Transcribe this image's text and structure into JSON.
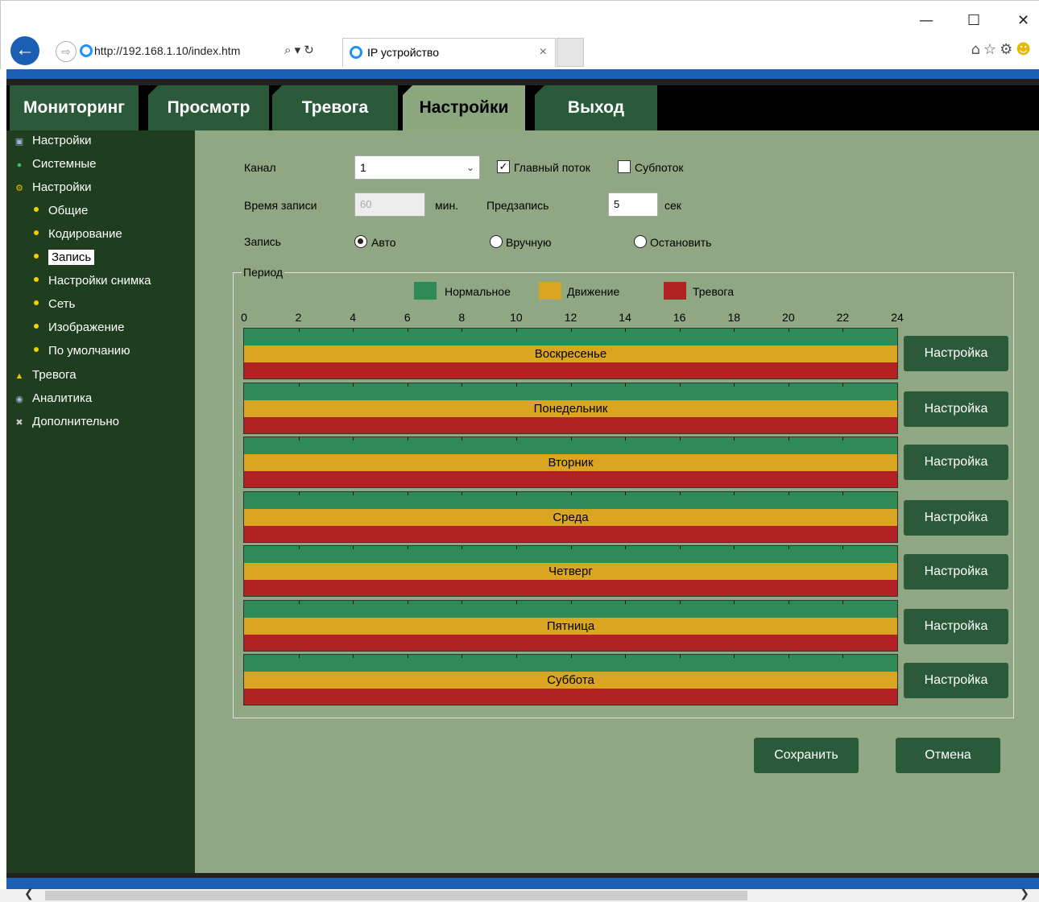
{
  "browser": {
    "url": "http://192.168.1.10/index.htm",
    "address_buttons": "⌕ ▾ ↻",
    "tab_title": "IP устройство",
    "tab_close": "×",
    "window_minimize": "—",
    "window_maximize": "☐",
    "window_close": "✕",
    "icons": [
      "home-icon",
      "star-icon",
      "gear-icon",
      "smiley-icon"
    ]
  },
  "nav": {
    "tabs": [
      "Мониторинг",
      "Просмотр",
      "Тревога",
      "Настройки",
      "Выход"
    ],
    "active": "Настройки"
  },
  "sidebar": {
    "items": [
      {
        "label": "Настройки",
        "icon": "settings-icon",
        "sub": false
      },
      {
        "label": "Системные",
        "icon": "info-icon",
        "sub": false
      },
      {
        "label": "Настройки",
        "icon": "gear-icon",
        "sub": false
      },
      {
        "label": "Общие",
        "sub": true
      },
      {
        "label": "Кодирование",
        "sub": true
      },
      {
        "label": "Запись",
        "sub": true,
        "selected": true
      },
      {
        "label": "Настройки снимка",
        "sub": true
      },
      {
        "label": "Сеть",
        "sub": true
      },
      {
        "label": "Изображение",
        "sub": true
      },
      {
        "label": "По умолчанию",
        "sub": true
      },
      {
        "label": "Тревога",
        "icon": "alarm-icon",
        "sub": false
      },
      {
        "label": "Аналитика",
        "icon": "analytics-icon",
        "sub": false
      },
      {
        "label": "Дополнительно",
        "icon": "tools-icon",
        "sub": false
      }
    ]
  },
  "form": {
    "channel_label": "Канал",
    "channel_value": "1",
    "main_stream_label": "Главный поток",
    "main_stream_checked": true,
    "sub_stream_label": "Субпоток",
    "sub_stream_checked": false,
    "record_time_label": "Время записи",
    "record_time_value": "60",
    "minutes_unit": "мин.",
    "prerecord_label": "Предзапись",
    "prerecord_value": "5",
    "seconds_unit": "сек",
    "record_label": "Запись",
    "mode_auto": "Авто",
    "mode_manual": "Вручную",
    "mode_stop": "Остановить",
    "mode_selected": "Авто"
  },
  "period": {
    "legend": "Период",
    "legend_items": [
      {
        "label": "Нормальное",
        "color": "#2e8b57"
      },
      {
        "label": "Движение",
        "color": "#daa520"
      },
      {
        "label": "Тревога",
        "color": "#b22222"
      }
    ],
    "ticks": [
      "0",
      "2",
      "4",
      "6",
      "8",
      "10",
      "12",
      "14",
      "16",
      "18",
      "20",
      "22",
      "24"
    ],
    "days": [
      "Воскресенье",
      "Понедельник",
      "Вторник",
      "Среда",
      "Четверг",
      "Пятница",
      "Суббота"
    ],
    "setup_label": "Настройка"
  },
  "actions": {
    "save": "Сохранить",
    "cancel": "Отмена"
  },
  "colors": {
    "nav_tab": "#2b5a3a",
    "nav_tab_active": "#8ba77d",
    "sidebar_bg": "#1f3d1f",
    "content_bg": "#8fa883",
    "browser_accent": "#1a5fb4"
  }
}
